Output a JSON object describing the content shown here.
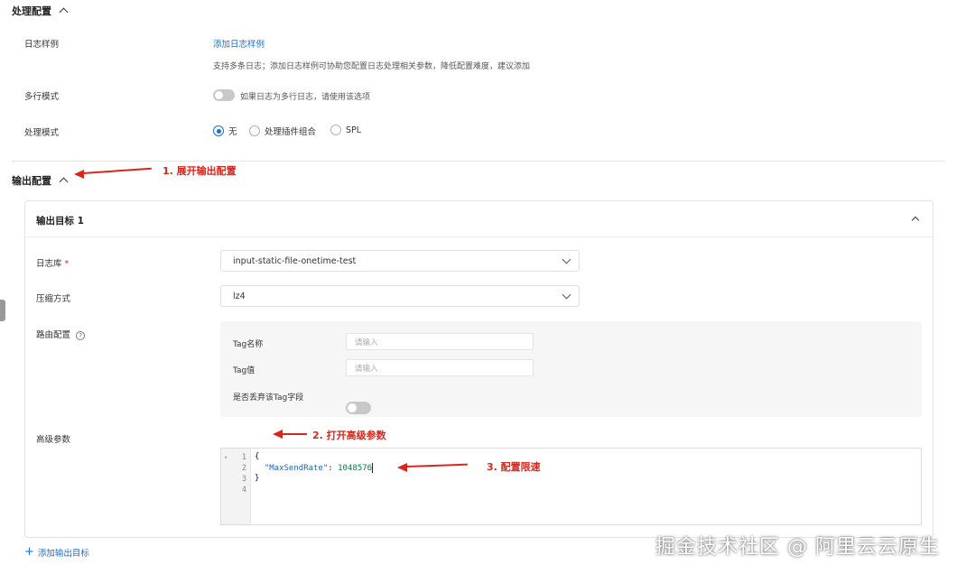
{
  "processing": {
    "title": "处理配置",
    "log_sample_label": "日志样例",
    "log_sample_link": "添加日志样例",
    "log_sample_hint": "支持多条日志；添加日志样例可协助您配置日志处理相关参数，降低配置难度，建议添加",
    "multiline_label": "多行模式",
    "multiline_hint": "如果日志为多行日志，请使用该选项",
    "multiline_on": false,
    "mode_label": "处理模式",
    "mode_options": [
      "无",
      "处理插件组合",
      "SPL"
    ],
    "mode_selected": "无"
  },
  "output": {
    "title": "输出配置",
    "target_title": "输出目标 1",
    "logstore_label": "日志库",
    "logstore_required_mark": "*",
    "logstore_value": "input-static-file-onetime-test",
    "compress_label": "压缩方式",
    "compress_value": "lz4",
    "route_label": "路由配置",
    "route_help": "?",
    "tag_name_label": "Tag名称",
    "tag_name_placeholder": "请输入",
    "tag_value_label": "Tag值",
    "tag_value_placeholder": "请输入",
    "discard_tag_label": "是否丢弃该Tag字段",
    "discard_tag_on": false,
    "advanced_label": "高级参数",
    "advanced_on": true,
    "add_target_label": "添加输出目标",
    "editor": {
      "line_numbers": [
        "1",
        "2",
        "3",
        "4"
      ],
      "line1": "{",
      "key": "\"MaxSendRate\"",
      "colon": ": ",
      "value": "1048576",
      "line3": "}",
      "line4": ""
    }
  },
  "annotations": {
    "a1": "1. 展开输出配置",
    "a2": "2. 打开高级参数",
    "a3": "3. 配置限速"
  },
  "watermark": "掘金技术社区 @ 阿里云云原生",
  "colors": {
    "accent": "#1d6fd6",
    "annotation": "#d9261c"
  }
}
